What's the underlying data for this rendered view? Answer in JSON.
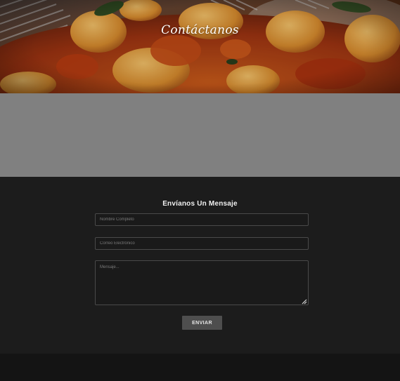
{
  "hero": {
    "title": "Contáctanos"
  },
  "contact_form": {
    "heading": "Envíanos Un Mensaje",
    "name_placeholder": "Nombre Completo",
    "email_placeholder": "Correo Electrónico",
    "message_placeholder": "Mensaje...",
    "submit_label": "ENVIAR"
  },
  "colors": {
    "map_placeholder": "#808080",
    "form_background": "#1c1c1c",
    "button": "#4e4e4e",
    "footer": "#141414"
  }
}
